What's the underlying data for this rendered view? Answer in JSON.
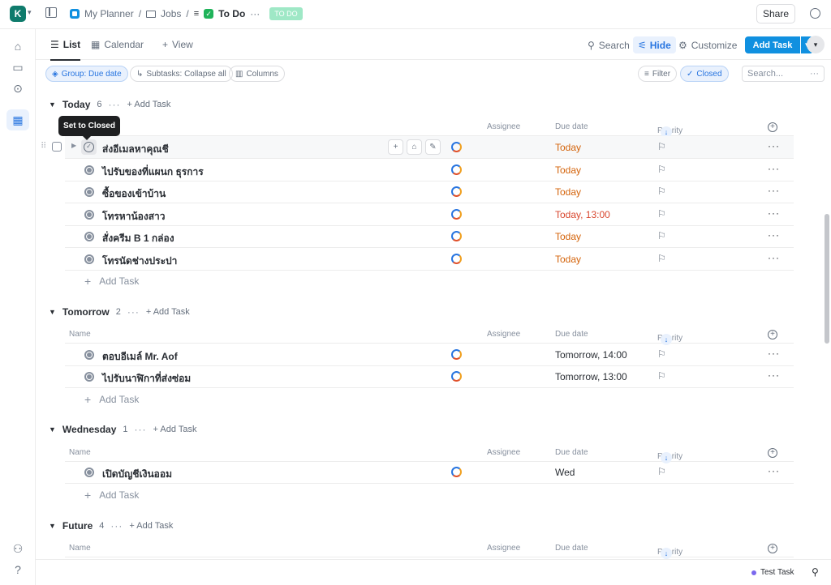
{
  "workspace": {
    "initial": "K"
  },
  "breadcrumb": {
    "space": "My Planner",
    "folder": "Jobs",
    "list": "To Do",
    "badge": "TO DO"
  },
  "topbar": {
    "share_label": "Share"
  },
  "views": {
    "list": "List",
    "calendar": "Calendar",
    "add_view": "View"
  },
  "toolbar": {
    "search": "Search",
    "hide": "Hide",
    "customize": "Customize",
    "add_task": "Add Task"
  },
  "filters": {
    "group": "Group: Due date",
    "subtasks": "Subtasks: Collapse all",
    "columns": "Columns",
    "filter": "Filter",
    "closed": "Closed",
    "search_placeholder": "Search..."
  },
  "tooltip": "Set to Closed",
  "columns": {
    "name": "Name",
    "assignee": "Assignee",
    "due_date": "Due date",
    "priority": "Priority"
  },
  "add_task_label": "Add Task",
  "groups": [
    {
      "name": "Today",
      "count": "6",
      "tasks": [
        {
          "name": "ส่งอีเมลหาคุณชี",
          "due": "Today"
        },
        {
          "name": "ไปรับของที่แผนก ธุรการ",
          "due": "Today"
        },
        {
          "name": "ซื้อของเข้าบ้าน",
          "due": "Today"
        },
        {
          "name": "โทรหาน้องสาว",
          "due": "Today, 13:00"
        },
        {
          "name": "สั่งครีม B 1 กล่อง",
          "due": "Today"
        },
        {
          "name": "โทรนัดช่างประปา",
          "due": "Today"
        }
      ]
    },
    {
      "name": "Tomorrow",
      "count": "2",
      "tasks": [
        {
          "name": "ตอบอีเมล์ Mr. Aof",
          "due": "Tomorrow, 14:00"
        },
        {
          "name": "ไปรับนาฬิกาที่ส่งซ่อม",
          "due": "Tomorrow, 13:00"
        }
      ]
    },
    {
      "name": "Wednesday",
      "count": "1",
      "tasks": [
        {
          "name": "เปิดบัญชีเงินออม",
          "due": "Wed"
        }
      ]
    },
    {
      "name": "Future",
      "count": "4",
      "tasks": []
    }
  ],
  "bottom": {
    "test_task": "Test Task"
  },
  "colors": {
    "accent": "#1090e0",
    "today": "#d4630a",
    "overdue_time": "#d9472f",
    "status_gray": "#87909e"
  }
}
